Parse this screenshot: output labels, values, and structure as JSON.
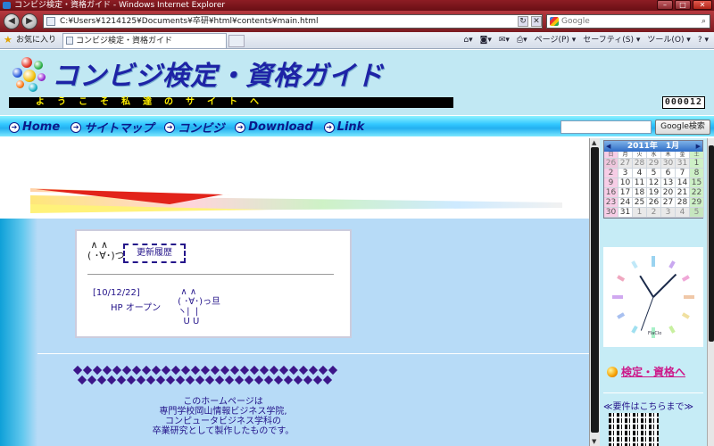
{
  "window": {
    "title": "コンビジ検定・資格ガイド - Windows Internet Explorer"
  },
  "address": {
    "url": "C:¥Users¥1214125¥Documents¥卒研¥html¥contents¥main.html",
    "search_placeholder": "Google"
  },
  "favbar": {
    "favorites_label": "お気に入り",
    "tab_title": "コンビジ検定・資格ガイド",
    "tools": [
      "ページ(P) ▾",
      "セーフティ(S) ▾",
      "ツール(O) ▾",
      "? ▾"
    ]
  },
  "header": {
    "site_title": "コンビジ検定・資格ガイド",
    "marquee": "ようこそ私達のサイトへ",
    "counter": "000012"
  },
  "menu": {
    "items": [
      "Home",
      "サイトマップ",
      "コンビジ",
      "Download",
      "Link"
    ],
    "google_button": "Google検索"
  },
  "news": {
    "face": " ∧ ∧\n( ･∀･)つ",
    "title": "更新履歴",
    "date": "[10/12/22]",
    "text": "HP オープン",
    "ascii": "  ∧ ∧\n ( ･∀･)っ旦\n ヽ|  |\n   U U"
  },
  "about": {
    "lines": [
      "このホームページは",
      "専門学校岡山情報ビジネス学院,",
      "コンピュータビジネス学科の",
      "卒業研究として製作したものです。"
    ]
  },
  "calendar": {
    "title": "2011年　1月",
    "dow": [
      "日",
      "月",
      "火",
      "水",
      "木",
      "金",
      "土"
    ],
    "weeks": [
      [
        "26",
        "27",
        "28",
        "29",
        "30",
        "31",
        "1"
      ],
      [
        "2",
        "3",
        "4",
        "5",
        "6",
        "7",
        "8"
      ],
      [
        "9",
        "10",
        "11",
        "12",
        "13",
        "14",
        "15"
      ],
      [
        "16",
        "17",
        "18",
        "19",
        "20",
        "21",
        "22"
      ],
      [
        "23",
        "24",
        "25",
        "26",
        "27",
        "28",
        "29"
      ],
      [
        "30",
        "31",
        "1",
        "2",
        "3",
        "4",
        "5"
      ]
    ]
  },
  "clock": {
    "brand": "FlaClo"
  },
  "sidebar": {
    "qual_link": "検定・資格へ",
    "req_link": "≪要件はこちらまで≫"
  },
  "colors": {
    "title_blue": "#1e23a6",
    "marquee_yellow": "#fff000",
    "link_pink": "#cc1a8a",
    "text_navy": "#24148a"
  }
}
